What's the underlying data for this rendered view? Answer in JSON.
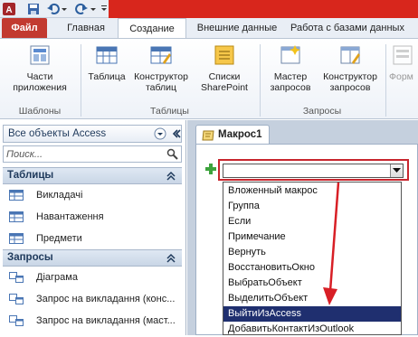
{
  "ribbon": {
    "tabs": {
      "file": "Файл",
      "home": "Главная",
      "create": "Создание",
      "external": "Внешние данные",
      "db": "Работа с базами данных"
    },
    "buttons": {
      "app_parts_1": "Части",
      "app_parts_2": "приложения",
      "table": "Таблица",
      "table_designer_1": "Конструктор",
      "table_designer_2": "таблиц",
      "sp_lists_1": "Списки",
      "sp_lists_2": "SharePoint",
      "query_wizard_1": "Мастер",
      "query_wizard_2": "запросов",
      "query_designer_1": "Конструктор",
      "query_designer_2": "запросов",
      "form": "Форм"
    },
    "groups": {
      "templates": "Шаблоны",
      "tables": "Таблицы",
      "queries": "Запросы"
    }
  },
  "nav": {
    "title": "Все объекты Access",
    "search_placeholder": "Поиск...",
    "sections": [
      {
        "label": "Таблицы",
        "items": [
          "Викладачі",
          "Навантаження",
          "Предмети"
        ]
      },
      {
        "label": "Запросы",
        "items": [
          "Діаграма",
          "Запрос на викладання (конс...",
          "Запрос на викладання (маст..."
        ]
      }
    ]
  },
  "doc": {
    "tab_label": "Макрос1",
    "combo_value": "",
    "options": [
      "Вложенный макрос",
      "Группа",
      "Если",
      "Примечание",
      "Вернуть",
      "ВосстановитьОкно",
      "ВыбратьОбъект",
      "ВыделитьОбъект",
      "ВыйтиИзAccess",
      "ДобавитьКонтактИзOutlook"
    ],
    "selected_option": "ВыйтиИзAccess"
  },
  "colors": {
    "accent_red": "#d8261c",
    "file_tab": "#c23a30",
    "selection": "#1f2f6f",
    "highlight_outline": "#c8262e"
  }
}
